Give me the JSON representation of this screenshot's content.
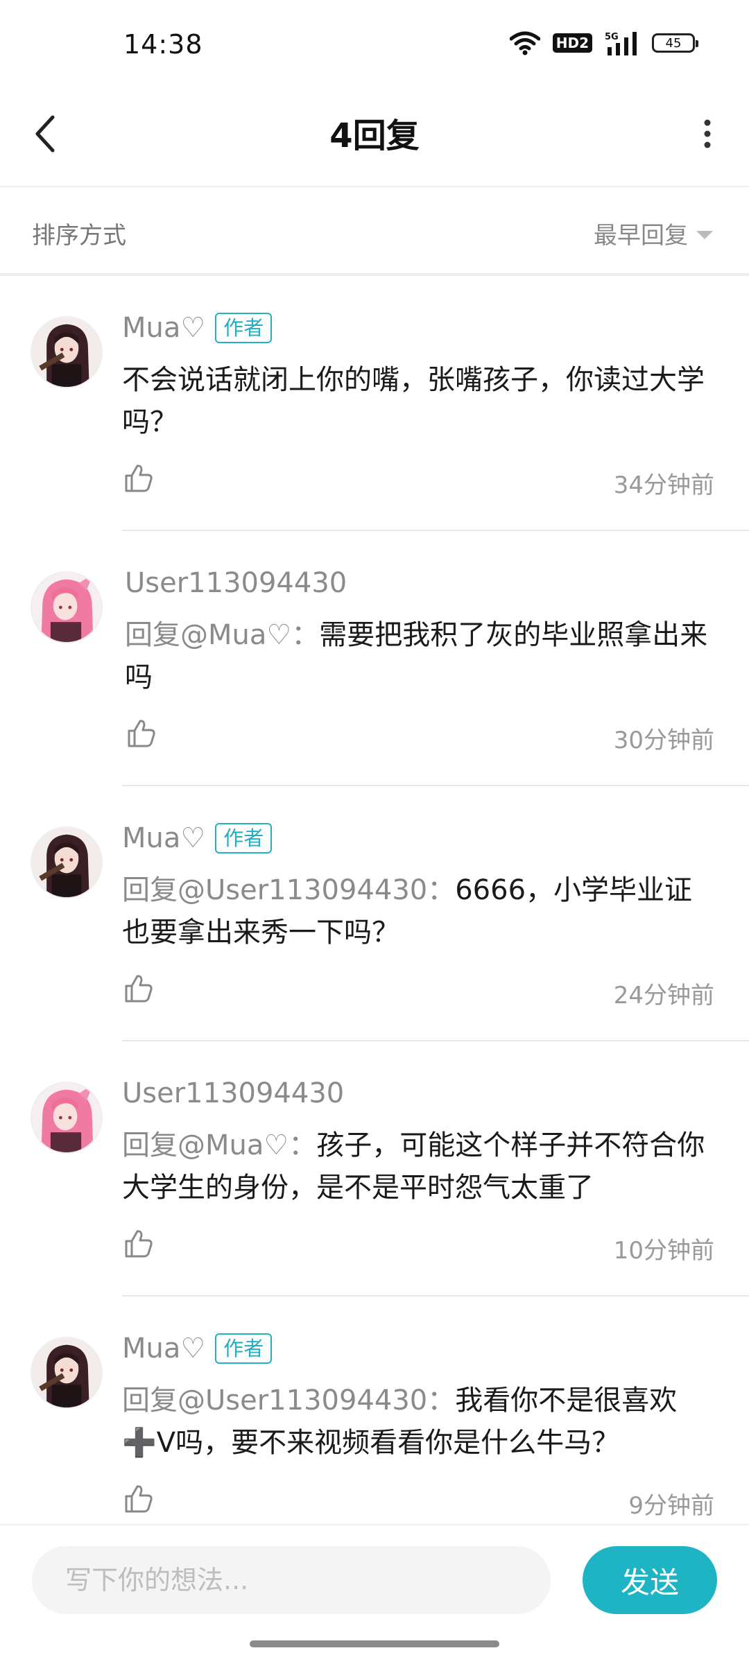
{
  "status_bar": {
    "time": "14:38",
    "network_badge": "HD2",
    "cell_label": "5G",
    "battery": "45"
  },
  "header": {
    "title": "4回复",
    "back_icon": "chevron-left-icon",
    "more_icon": "more-vertical-icon"
  },
  "sort": {
    "label": "排序方式",
    "value": "最早回复"
  },
  "comments": [
    {
      "name": "Mua♡",
      "badge": "作者",
      "mention": "",
      "text": "不会说话就闭上你的嘴，张嘴孩子，你读过大学吗？",
      "time": "34分钟前",
      "avatar": "dark-haired-character"
    },
    {
      "name": "User113094430",
      "badge": "",
      "mention": "回复@Mua♡：",
      "text": "需要把我积了灰的毕业照拿出来吗",
      "time": "30分钟前",
      "avatar": "pink-haired-character"
    },
    {
      "name": "Mua♡",
      "badge": "作者",
      "mention": "回复@User113094430：",
      "text": "6666，小学毕业证也要拿出来秀一下吗？",
      "time": "24分钟前",
      "avatar": "dark-haired-character"
    },
    {
      "name": "User113094430",
      "badge": "",
      "mention": "回复@Mua♡：",
      "text": "孩子，可能这个样子并不符合你大学生的身份，是不是平时怨气太重了",
      "time": "10分钟前",
      "avatar": "pink-haired-character"
    },
    {
      "name": "Mua♡",
      "badge": "作者",
      "mention": "回复@User113094430：",
      "text": "我看你不是很喜欢➕V吗，要不来视频看看你是什么牛马？",
      "time": "9分钟前",
      "avatar": "dark-haired-character"
    }
  ],
  "input": {
    "placeholder": "写下你的想法...",
    "send_label": "发送"
  },
  "colors": {
    "accent": "#1fb4c4",
    "author_badge": "#1fb0c2",
    "muted_text": "#8a8a8a"
  }
}
